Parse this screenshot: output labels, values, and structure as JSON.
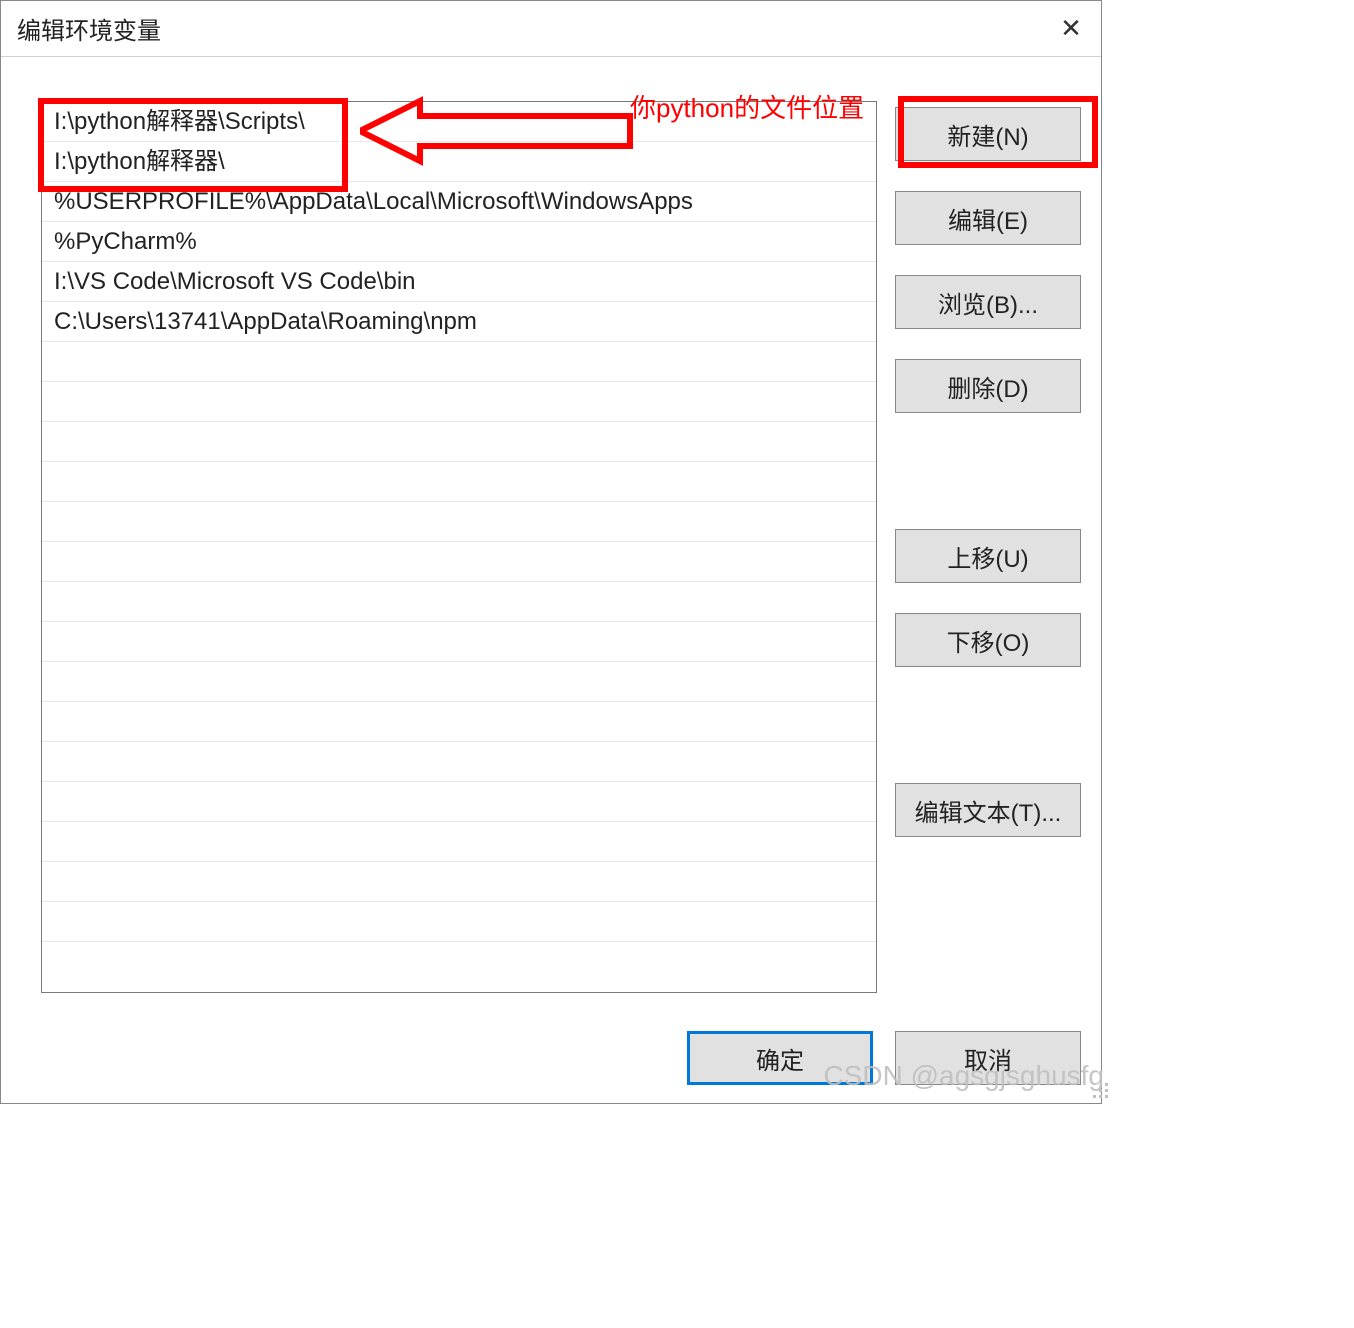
{
  "titlebar": {
    "title": "编辑环境变量"
  },
  "list": {
    "items": [
      "I:\\python解释器\\Scripts\\",
      "I:\\python解释器\\",
      "%USERPROFILE%\\AppData\\Local\\Microsoft\\WindowsApps",
      "%PyCharm%",
      "I:\\VS Code\\Microsoft VS Code\\bin",
      "C:\\Users\\13741\\AppData\\Roaming\\npm"
    ]
  },
  "buttons": {
    "new": "新建(N)",
    "edit": "编辑(E)",
    "browse": "浏览(B)...",
    "delete": "删除(D)",
    "moveup": "上移(U)",
    "movedown": "下移(O)",
    "edittext": "编辑文本(T)..."
  },
  "footer": {
    "ok": "确定",
    "cancel": "取消"
  },
  "annotation": {
    "text": "你python的文件位置"
  },
  "watermark": "CSDN @agsgjsghusfg"
}
